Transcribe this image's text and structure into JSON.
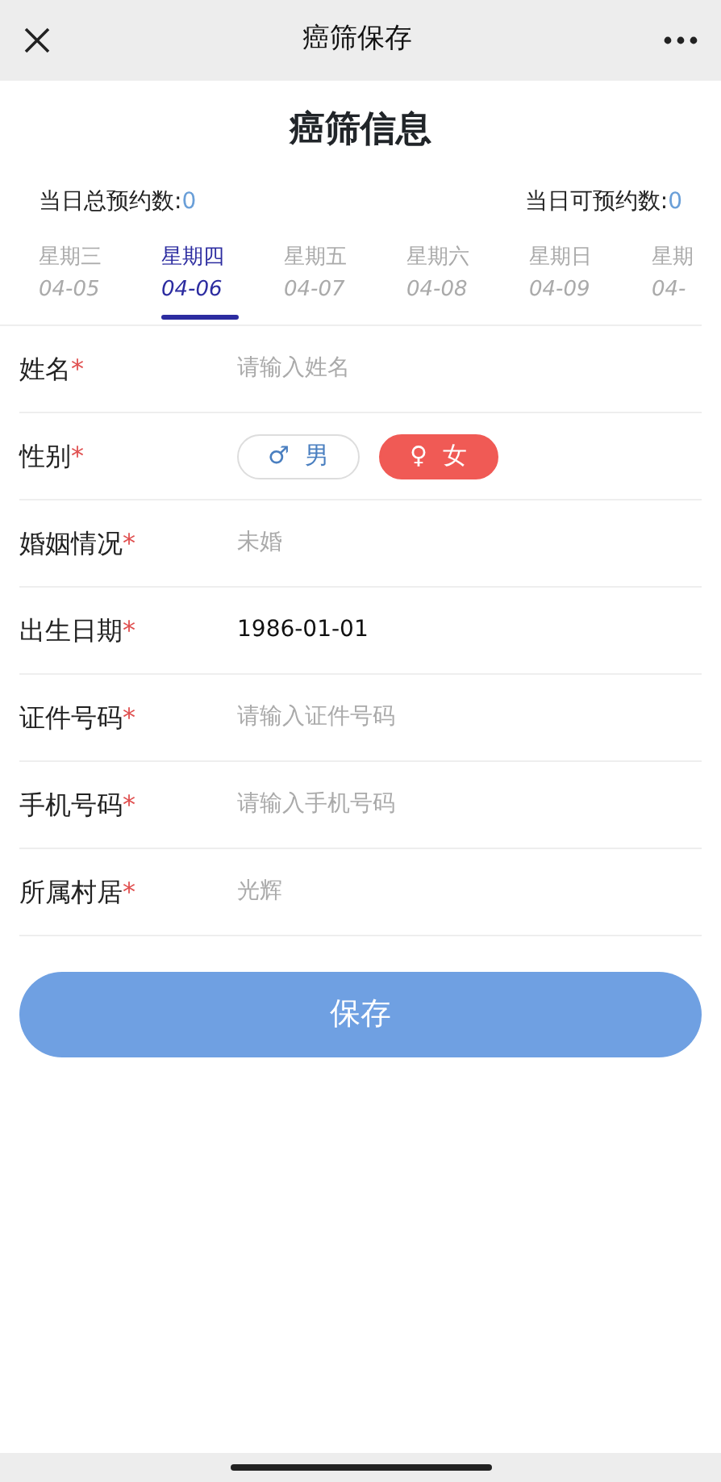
{
  "nav_bar": {
    "title": "癌筛保存"
  },
  "heading": "癌筛信息",
  "counts": [
    {
      "label": "当日总预约数:",
      "value": "0"
    },
    {
      "label": "当日可预约数:",
      "value": "0"
    }
  ],
  "day_tabs": [
    {
      "weekday": "星期三",
      "date": "04-05",
      "selected": false
    },
    {
      "weekday": "星期四",
      "date": "04-06",
      "selected": true
    },
    {
      "weekday": "星期五",
      "date": "04-07",
      "selected": false
    },
    {
      "weekday": "星期六",
      "date": "04-08",
      "selected": false
    },
    {
      "weekday": "星期日",
      "date": "04-09",
      "selected": false
    },
    {
      "weekday": "星期",
      "date": "04-",
      "selected": false
    }
  ],
  "form_rows": [
    {
      "kind": "input",
      "label": "姓名",
      "required_mark": "*",
      "placeholder": "请输入姓名"
    },
    {
      "kind": "choice",
      "label": "性别",
      "required_mark": "*",
      "options": [
        {
          "symbol": "♂",
          "text": "男",
          "selected": false
        },
        {
          "symbol": "♀",
          "text": "女",
          "selected": true
        }
      ]
    },
    {
      "kind": "input",
      "label": "婚姻情况",
      "required_mark": "*",
      "placeholder": "未婚"
    },
    {
      "kind": "input",
      "label": "出生日期",
      "required_mark": "*",
      "value": "1986-01-01"
    },
    {
      "kind": "input",
      "label": "证件号码",
      "required_mark": "*",
      "placeholder": "请输入证件号码"
    },
    {
      "kind": "input",
      "label": "手机号码",
      "required_mark": "*",
      "placeholder": "请输入手机号码"
    },
    {
      "kind": "input",
      "label": "所属村居",
      "required_mark": "*",
      "placeholder": "光辉"
    }
  ],
  "save_button": "保存"
}
